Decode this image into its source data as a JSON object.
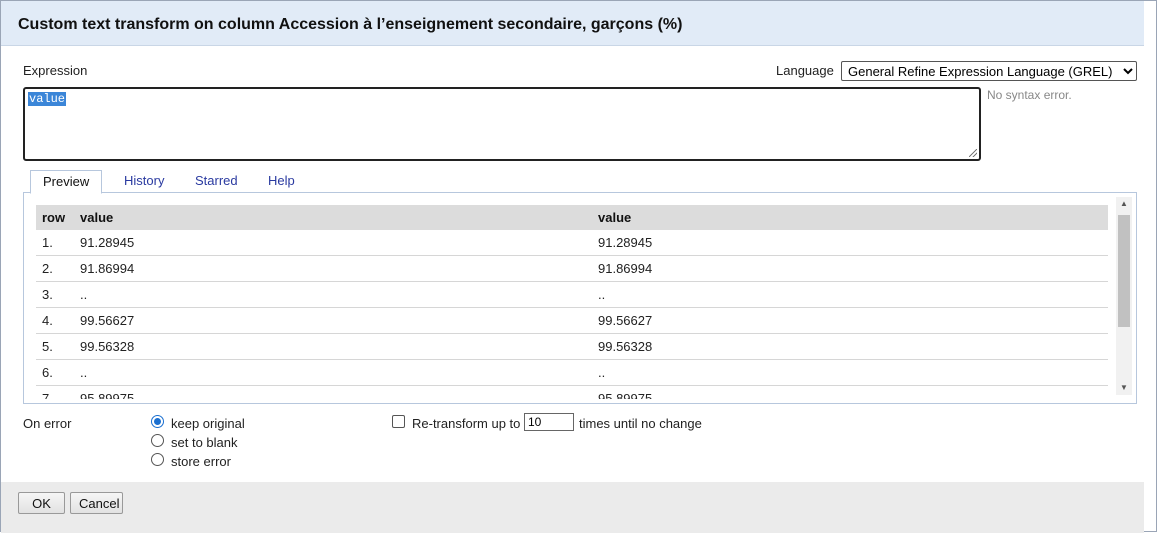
{
  "dialog": {
    "title": "Custom text transform on column Accession à l’enseignement secondaire, garçons (%)"
  },
  "expression": {
    "label": "Expression",
    "value": "value",
    "syntax_status": "No syntax error."
  },
  "language": {
    "label": "Language",
    "selected": "General Refine Expression Language (GREL)"
  },
  "tabs": [
    {
      "label": "Preview",
      "active": true
    },
    {
      "label": "History",
      "active": false
    },
    {
      "label": "Starred",
      "active": false
    },
    {
      "label": "Help",
      "active": false
    }
  ],
  "preview": {
    "headers": [
      "row",
      "value",
      "value"
    ],
    "rows": [
      {
        "row": "1.",
        "original": "91.28945",
        "result": "91.28945"
      },
      {
        "row": "2.",
        "original": "91.86994",
        "result": "91.86994"
      },
      {
        "row": "3.",
        "original": "..",
        "result": ".."
      },
      {
        "row": "4.",
        "original": "99.56627",
        "result": "99.56627"
      },
      {
        "row": "5.",
        "original": "99.56328",
        "result": "99.56328"
      },
      {
        "row": "6.",
        "original": "..",
        "result": ".."
      },
      {
        "row": "7.",
        "original": "95.89975",
        "result": "95.89975"
      }
    ]
  },
  "on_error": {
    "label": "On error",
    "options": [
      {
        "label": "keep original",
        "checked": true
      },
      {
        "label": "set to blank",
        "checked": false
      },
      {
        "label": "store error",
        "checked": false
      }
    ]
  },
  "retransform": {
    "label_before": "Re-transform up to",
    "value": "10",
    "label_after": "times until no change",
    "checked": false
  },
  "buttons": {
    "ok": "OK",
    "cancel": "Cancel"
  },
  "colors": {
    "titlebar_bg": "#e1ebf7",
    "accent": "#1a6fd0",
    "tab_link": "#2a3aa0",
    "selection": "#3b86d8"
  }
}
